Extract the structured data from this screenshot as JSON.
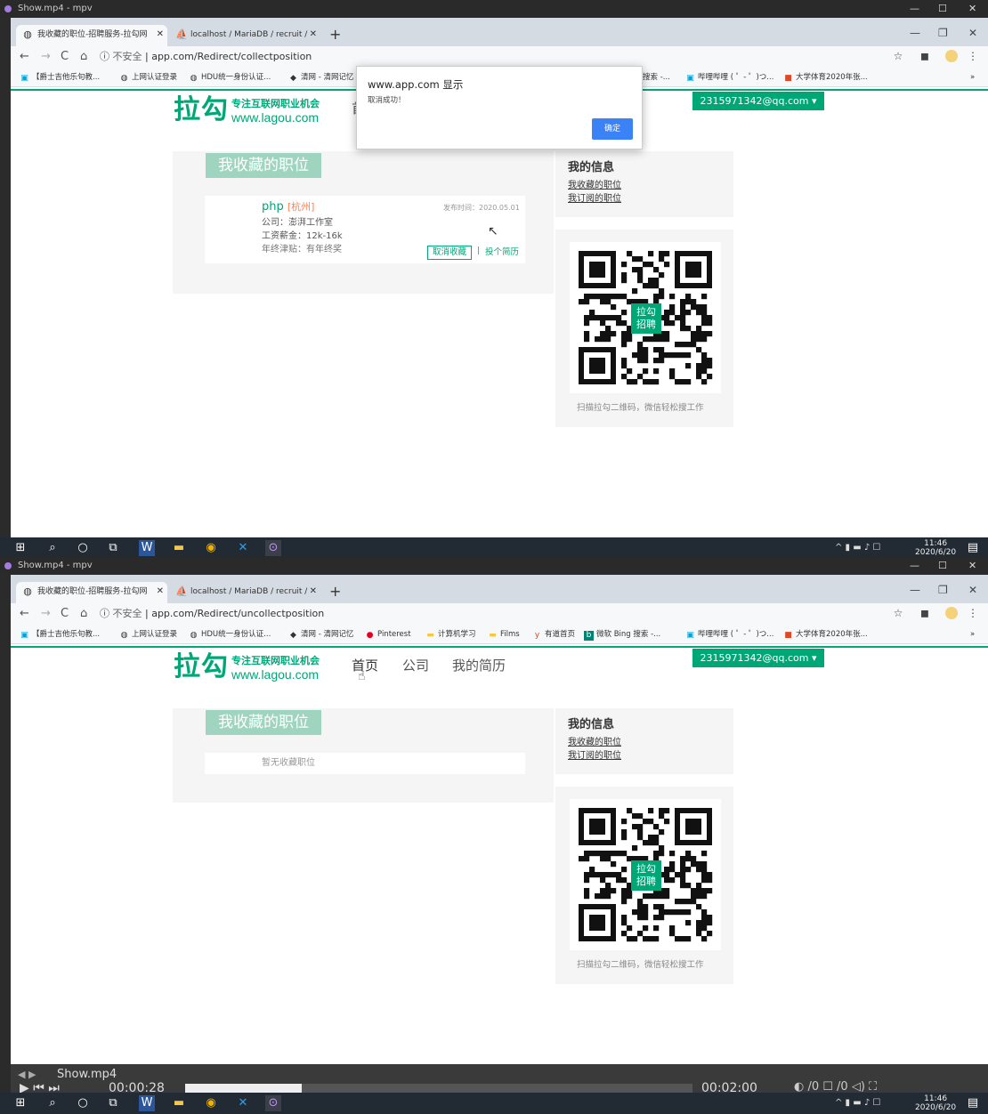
{
  "player": {
    "title": "Show.mp4 - mpv",
    "filename": "Show.mp4",
    "time_current": "00:00:28",
    "time_total": "00:02:00",
    "progress": 0.23
  },
  "browser": {
    "tabs": [
      {
        "title": "我收藏的职位-招聘服务-拉勾网",
        "icon": "globe-icon"
      },
      {
        "title": "localhost / MariaDB / recruit /",
        "icon": "phpmyadmin-icon"
      }
    ],
    "new_tab": "+",
    "insecure_label": "不安全",
    "url_host": "app.com",
    "frames": [
      {
        "url_path": "/Redirect/collectposition"
      },
      {
        "url_path": "/Redirect/uncollectposition"
      }
    ],
    "bookmarks": [
      {
        "label": "【爵士吉他乐句教...",
        "icon": "bilibili-icon"
      },
      {
        "label": "上网认证登录",
        "icon": "globe-icon"
      },
      {
        "label": "HDU统一身份认证...",
        "icon": "globe-icon"
      },
      {
        "label": "清网 - 清网记忆",
        "icon": "bookmark-icon"
      },
      {
        "label": "Pinterest",
        "icon": "pinterest-icon"
      },
      {
        "label": "计算机学习",
        "icon": "folder-icon"
      },
      {
        "label": "Films",
        "icon": "folder-icon"
      },
      {
        "label": "有道首页",
        "icon": "youdao-icon"
      },
      {
        "label": "微软 Bing 搜索 -...",
        "icon": "bing-icon"
      },
      {
        "label": "哔哩哔哩 ( ゜- ゜)つ...",
        "icon": "bilibili-icon"
      },
      {
        "label": "大学体育2020年张...",
        "icon": "app-icon"
      }
    ],
    "bookmarks_visible_frame1_tail": "搜索 -...",
    "bookmarks_more": "»"
  },
  "site": {
    "logo_main": "拉勾",
    "logo_tagline": "专注互联网职业机会",
    "logo_domain": "www.lagou.com",
    "nav": [
      "首页",
      "公司",
      "我的简历"
    ],
    "nav_partial": "首",
    "user_email": "2315971342@qq.com",
    "user_caret": "▾",
    "section_title": "我收藏的职位",
    "job": {
      "title": "php",
      "city": "[杭州]",
      "company": "公司：澎湃工作室",
      "salary": "工资薪金：12k-16k",
      "bonus": "年终津贴：有年终奖",
      "date": "发布时间：2020.05.01",
      "uncollect_label": "取消收藏",
      "separator": "|",
      "apply_label": "投个简历"
    },
    "empty_text": "暂无收藏职位",
    "my_info": {
      "title": "我的信息",
      "links": [
        "我收藏的职位",
        "我订阅的职位"
      ]
    },
    "qr": {
      "caption": "扫描拉勾二维码，微信轻松搜工作",
      "overlay": [
        "拉勾",
        "招聘"
      ]
    }
  },
  "dialog": {
    "title": "www.app.com 显示",
    "message": "取消成功！",
    "ok_label": "确定"
  },
  "taskbar": {
    "time": "11:46",
    "date": "2020/6/20",
    "notif_count": "5"
  },
  "colors": {
    "brand": "#00a776",
    "section_title_bg": "#9fd5c0",
    "taskbar": "#222a33",
    "dialog_ok": "#3b82f6"
  }
}
